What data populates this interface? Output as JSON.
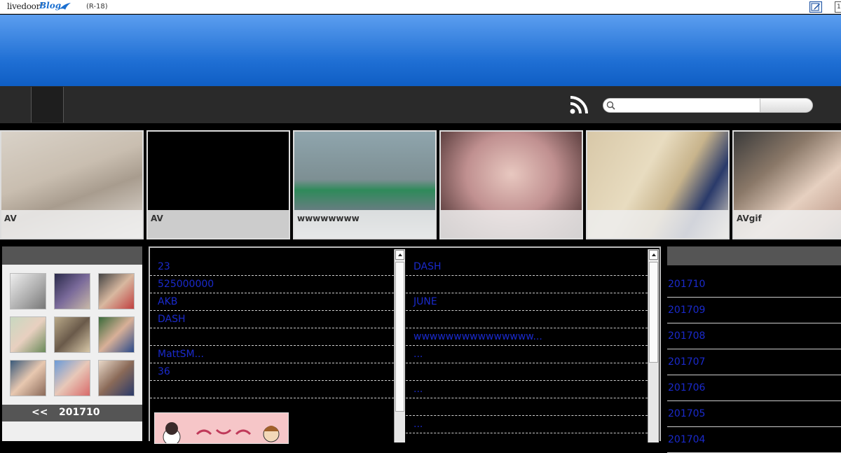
{
  "topbar": {
    "logo_text": "livedoor",
    "logo_sup": "®",
    "blog_text": "Blog",
    "rating": "(R-18)",
    "counter": "1"
  },
  "search": {
    "placeholder": ""
  },
  "thumbnails": [
    {
      "caption": "AV"
    },
    {
      "caption": "AV"
    },
    {
      "caption": "wwwwwwww"
    },
    {
      "caption": ""
    },
    {
      "caption": ""
    },
    {
      "caption": "AVgif"
    }
  ],
  "calendar": {
    "prev_label": "<<",
    "month": "201710"
  },
  "latest_left": [
    "23",
    "525000000",
    "AKB",
    "DASH",
    "",
    "MattSM...",
    "36",
    ""
  ],
  "latest_right": [
    "DASH",
    "",
    "JUNE",
    "",
    "wwwwwwwwwwwwwww...",
    "...",
    "",
    "...",
    "",
    "..."
  ],
  "archives": [
    "201710",
    "201709",
    "201708",
    "201707",
    "201706",
    "201705",
    "201704"
  ],
  "colors": {
    "header_top": "#5c9eef",
    "header_bottom": "#0f5ec4",
    "link": "#1a2acc",
    "panel_dark": "#555555"
  }
}
